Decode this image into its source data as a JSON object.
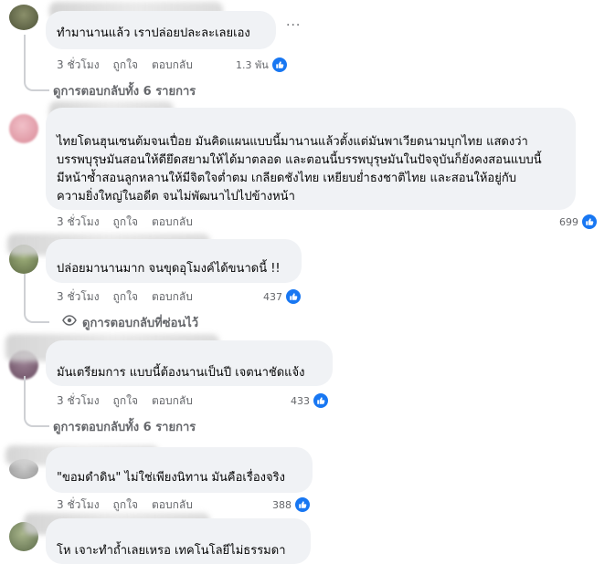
{
  "actions": {
    "time": "3 ชั่วโมง",
    "like": "ถูกใจ",
    "reply": "ตอบกลับ"
  },
  "more_menu": "···",
  "comments": [
    {
      "lines": [
        "ทำมานานแล้ว เราปล่อยปละละเลยเอง"
      ],
      "likes": "1.3 พัน",
      "replies_link": "ดูการตอบกลับทั้ง 6 รายการ"
    },
    {
      "lines": [
        "ไทยโดนฮุนเซนต้มจนเปื่อย มันคิดแผนแบบนี้มานานแล้วตั้งแต่มันพาเวียดนามบุกไทย แสดงว่า",
        "บรรพบุรุษมันสอนให้ดียึดสยามให้ได้มาตลอด และตอนนี้บรรพบุรุษมันในปัจจุบันก็ยังคงสอนแบบนี้",
        "มีหน้าซ้ำสอนลูกหลานให้มีจิตใจต่ำตม เกลียดชังไทย เหยียบย่ำธงชาติไทย และสอนให้อยู่กับ",
        "ความยิ่งใหญ่ในอดีต จนไม่พัฒนาไปไปข้างหน้า"
      ],
      "likes": "699"
    },
    {
      "lines": [
        "ปล่อยมานานมาก จนขุดอุโมงค์ได้ขนาดนี้ !!"
      ],
      "likes": "437",
      "replies_link": "ดูการตอบกลับที่ซ่อนไว้"
    },
    {
      "lines": [
        "มันเตรียมการ แบบนี้ต้องนานเป็นปี เจตนาชัดแจ้ง"
      ],
      "likes": "433",
      "replies_link": "ดูการตอบกลับทั้ง 6 รายการ"
    },
    {
      "lines": [
        "\"ขอมดำดิน\" ไม่ใช่เพียงนิทาน มันคือเรื่องจริง"
      ],
      "likes": "388"
    },
    {
      "lines": [
        "โห เจาะทำถ้ำเลยเหรอ เทคโนโลยีไม่ธรรมดา"
      ]
    }
  ],
  "colors": {
    "bubble": "#f0f2f5",
    "like_blue": "#1877f2",
    "meta_gray": "#65676b"
  },
  "icons": [
    "like-thumb-icon",
    "eye-icon",
    "more-options-icon"
  ]
}
